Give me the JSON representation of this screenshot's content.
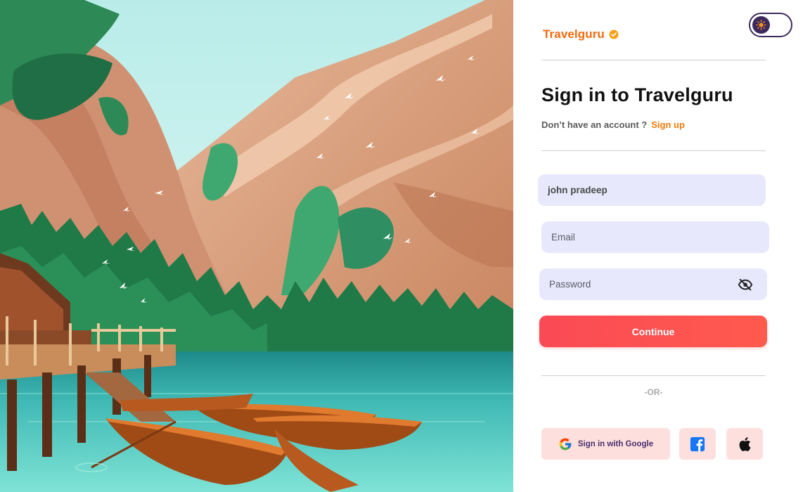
{
  "brand": {
    "name": "Travelguru",
    "accent": "#f46a0e"
  },
  "theme_toggle": {
    "icon": "sun-icon",
    "state": "light"
  },
  "signin": {
    "title": "Sign in to Travelguru",
    "prompt": "Don’t have an account ?",
    "signup_label": "Sign up"
  },
  "form": {
    "name_value": "john pradeep",
    "email_placeholder": "Email",
    "password_placeholder": "Password",
    "password_toggle_icon": "eye-off-icon",
    "continue_label": "Continue"
  },
  "divider_text": "-OR-",
  "social": {
    "google_label": "Sign in with Google",
    "google_icon": "google-icon",
    "facebook_icon": "facebook-icon",
    "apple_icon": "apple-icon"
  },
  "colors": {
    "field_bg": "#e7e8fb",
    "button_red": "#fa4a55",
    "social_bg": "#fde0dd",
    "toggle_purple": "#3d2a5c"
  }
}
